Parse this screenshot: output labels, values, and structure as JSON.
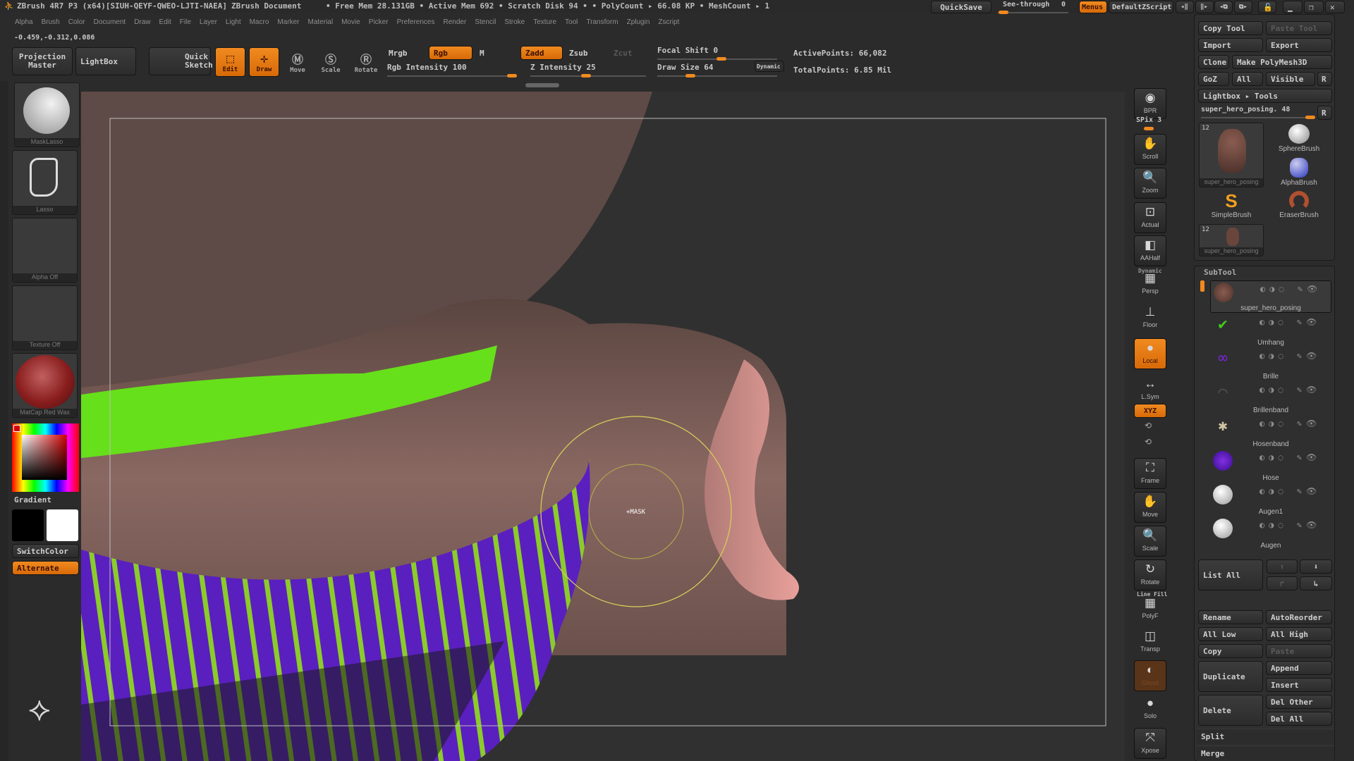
{
  "window": {
    "app_title": "ZBrush 4R7 P3 (x64)[SIUH-QEYF-QWEO-LJTI-NAEA]",
    "document": "ZBrush Document",
    "status": "• Free Mem 28.131GB • Active Mem 692 • Scratch Disk 94 •  • PolyCount ▸ 66.08 KP  • MeshCount ▸ 1",
    "quicksave": "QuickSave",
    "see_through_label": "See-through",
    "see_through_value": "0",
    "menus": "Menus",
    "default_zscript": "DefaultZScript"
  },
  "menubar": [
    "Alpha",
    "Brush",
    "Color",
    "Document",
    "Draw",
    "Edit",
    "File",
    "Layer",
    "Light",
    "Macro",
    "Marker",
    "Material",
    "Movie",
    "Picker",
    "Preferences",
    "Render",
    "Stencil",
    "Stroke",
    "Texture",
    "Tool",
    "Transform",
    "Zplugin",
    "Zscript"
  ],
  "coords": "-0.459,-0.312,0.086",
  "toolbar": {
    "projection_master": "Projection Master",
    "lightbox": "LightBox",
    "quick_sketch": "Quick Sketch",
    "edit": "Edit",
    "draw": "Draw",
    "move": "Move",
    "scale": "Scale",
    "rotate": "Rotate",
    "mrgb": "Mrgb",
    "rgb": "Rgb",
    "m": "M",
    "rgb_intensity": "Rgb Intensity 100",
    "zadd": "Zadd",
    "zsub": "Zsub",
    "zcut": "Zcut",
    "z_intensity": "Z Intensity 25",
    "focal_shift": "Focal Shift 0",
    "draw_size": "Draw Size 64",
    "dynamic": "Dynamic",
    "active_points": "ActivePoints: 66,082",
    "total_points": "TotalPoints: 6.85 Mil"
  },
  "left_shelf": {
    "brush": "MaskLasso",
    "stroke": "Lasso",
    "alpha": "Alpha Off",
    "texture": "Texture Off",
    "material": "MatCap Red Wax",
    "gradient": "Gradient",
    "switch_color": "SwitchColor",
    "alternate": "Alternate"
  },
  "viewport": {
    "cursor_label": "+MASK"
  },
  "right_shelf": [
    {
      "label": "BPR",
      "icon": "◉"
    },
    {
      "label": "Scroll",
      "icon": "✋"
    },
    {
      "label": "Zoom",
      "icon": "🔍"
    },
    {
      "label": "Actual",
      "icon": "⊡"
    },
    {
      "label": "AAHalf",
      "icon": "◧"
    },
    {
      "label": "Persp",
      "icon": "▦"
    },
    {
      "label": "Floor",
      "icon": "⊥"
    },
    {
      "label": "Local",
      "icon": "●"
    },
    {
      "label": "L.Sym",
      "icon": "↔"
    },
    {
      "label": "Frame",
      "icon": "⛶"
    },
    {
      "label": "Move",
      "icon": "✋"
    },
    {
      "label": "Scale",
      "icon": "🔍"
    },
    {
      "label": "Rotate",
      "icon": "↻"
    },
    {
      "label": "PolyF",
      "icon": "▦"
    },
    {
      "label": "Transp",
      "icon": "◫"
    },
    {
      "label": "Ghost",
      "icon": "◐"
    },
    {
      "label": "Solo",
      "icon": "●"
    },
    {
      "label": "Xpose",
      "icon": "⤧"
    }
  ],
  "right_shelf_misc": {
    "spix": "SPix 3",
    "xyz": "XYZ",
    "dynamic_label": "Dynamic",
    "line_fill": "Line Fill"
  },
  "tool_panel": {
    "copy_tool": "Copy Tool",
    "paste_tool": "Paste Tool",
    "import": "Import",
    "export": "Export",
    "clone": "Clone",
    "make_polymesh": "Make PolyMesh3D",
    "goz": "GoZ",
    "all": "All",
    "visible": "Visible",
    "r": "R",
    "lightbox_tools": "Lightbox ▸ Tools",
    "current_tool": "super_hero_posing. 48",
    "tools": [
      {
        "name": "super_hero_posing",
        "count": "12"
      },
      {
        "name": "SphereBrush"
      },
      {
        "name": "AlphaBrush"
      },
      {
        "name": "SimpleBrush"
      },
      {
        "name": "EraserBrush"
      },
      {
        "name": "super_hero_posing",
        "count": "12"
      }
    ]
  },
  "subtool": {
    "title": "SubTool",
    "items": [
      {
        "name": "super_hero_posing",
        "selected": true
      },
      {
        "name": "Umhang"
      },
      {
        "name": "Brille"
      },
      {
        "name": "Brillenband"
      },
      {
        "name": "Hosenband"
      },
      {
        "name": "Hose"
      },
      {
        "name": "Augen1"
      },
      {
        "name": "Augen"
      }
    ],
    "list_all": "List All",
    "rename": "Rename",
    "auto_reorder": "AutoReorder",
    "all_low": "All Low",
    "all_high": "All High",
    "copy": "Copy",
    "paste": "Paste",
    "duplicate": "Duplicate",
    "append": "Append",
    "insert": "Insert",
    "delete": "Delete",
    "del_other": "Del Other",
    "del_all": "Del All",
    "split": "Split",
    "merge": "Merge"
  },
  "colors": {
    "accent": "#f08a20",
    "background": "#2b2b2b",
    "viewport": "#303030"
  }
}
